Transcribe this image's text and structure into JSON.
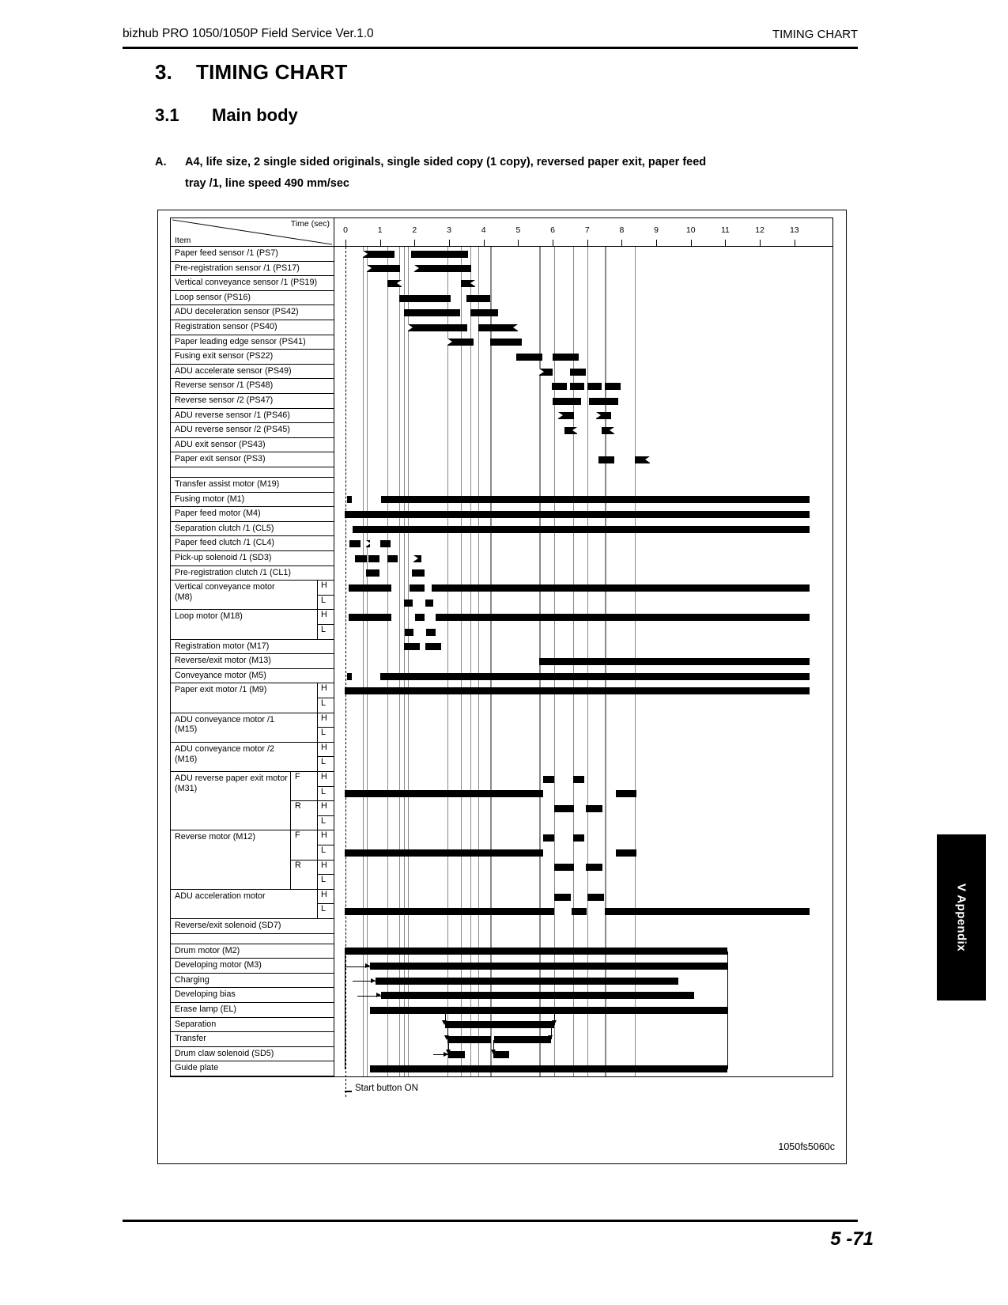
{
  "header": {
    "left": "bizhub PRO 1050/1050P Field Service Ver.1.0",
    "right": "TIMING CHART"
  },
  "titles": {
    "section_number": "3.",
    "section_title": "TIMING CHART",
    "sub_number": "3.1",
    "sub_title": "Main body",
    "item_label": "A.",
    "item_text": "A4, life size, 2 single sided originals, single sided copy (1 copy), reversed paper exit, paper feed",
    "item_text_line2": "tray /1, line speed 490 mm/sec"
  },
  "figure": {
    "id": "1050fs5060c",
    "axis_title": "Time (sec)",
    "item_header": "Item",
    "start_note": "Start button ON"
  },
  "side_tab": {
    "label": "V Appendix"
  },
  "footer": {
    "page": "5 -71"
  },
  "chart_data": {
    "type": "timing",
    "title": "Main body timing chart",
    "xlabel": "Time (sec)",
    "xlim": [
      -0.35,
      13.6
    ],
    "ticks": [
      0,
      1,
      2,
      3,
      4,
      5,
      6,
      7,
      8,
      9,
      10,
      11,
      12,
      13
    ],
    "tick_labels": [
      "0",
      "1",
      "2",
      "3",
      "4",
      "5",
      "6",
      "7",
      "8",
      "9",
      "10",
      "11",
      "12",
      "13"
    ],
    "start_marker": 0,
    "rows": [
      {
        "label": "Paper feed sensor /1 (PS7)",
        "sub": null,
        "bars": [
          {
            "x0": 0.5,
            "x1": 1.42,
            "lead": "open"
          },
          {
            "x0": 1.9,
            "x1": 3.56
          }
        ]
      },
      {
        "label": "Pre-registration sensor /1 (PS17)",
        "sub": null,
        "bars": [
          {
            "x0": 0.62,
            "x1": 1.58,
            "lead": "open"
          },
          {
            "x0": 2.0,
            "x1": 3.65,
            "lead": "open"
          }
        ]
      },
      {
        "label": "Vertical conveyance sensor /1 (PS19)",
        "sub": null,
        "bars": [
          {
            "x0": 1.22,
            "x1": 1.62,
            "tail": "open"
          },
          {
            "x0": 3.35,
            "x1": 3.75,
            "tail": "open"
          }
        ]
      },
      {
        "label": "Loop sensor (PS16)",
        "sub": null,
        "bars": [
          {
            "x0": 1.55,
            "x1": 3.05
          },
          {
            "x0": 3.5,
            "x1": 4.2
          }
        ]
      },
      {
        "label": "ADU deceleration sensor (PS42)",
        "sub": null,
        "bars": [
          {
            "x0": 1.7,
            "x1": 3.32
          },
          {
            "x0": 3.62,
            "x1": 4.42
          }
        ]
      },
      {
        "label": "Registration sensor (PS40)",
        "sub": null,
        "bars": [
          {
            "x0": 1.8,
            "x1": 3.52,
            "lead": "open"
          },
          {
            "x0": 3.85,
            "x1": 5.0,
            "tail": "open"
          }
        ]
      },
      {
        "label": "Paper leading edge sensor (PS41)",
        "sub": null,
        "bars": [
          {
            "x0": 2.95,
            "x1": 3.72,
            "lead": "open"
          },
          {
            "x0": 4.2,
            "x1": 5.1
          }
        ]
      },
      {
        "label": "Fusing exit sensor (PS22)",
        "sub": null,
        "bars": [
          {
            "x0": 4.95,
            "x1": 5.7
          },
          {
            "x0": 6.0,
            "x1": 6.75
          }
        ]
      },
      {
        "label": "ADU accelerate sensor (PS49)",
        "sub": null,
        "bars": [
          {
            "x0": 5.6,
            "x1": 6.0,
            "lead": "open"
          },
          {
            "x0": 6.5,
            "x1": 6.95
          }
        ]
      },
      {
        "label": "Reverse sensor /1 (PS48)",
        "sub": null,
        "bars": [
          {
            "x0": 5.98,
            "x1": 6.42
          },
          {
            "x0": 6.5,
            "x1": 6.92
          },
          {
            "x0": 7.0,
            "x1": 7.42
          },
          {
            "x0": 7.52,
            "x1": 7.96
          }
        ]
      },
      {
        "label": "Reverse sensor /2 (PS47)",
        "sub": null,
        "bars": [
          {
            "x0": 6.0,
            "x1": 6.82
          },
          {
            "x0": 7.05,
            "x1": 7.9
          }
        ]
      },
      {
        "label": "ADU reverse sensor /1 (PS46)",
        "sub": null,
        "bars": [
          {
            "x0": 6.15,
            "x1": 6.62,
            "lead": "open"
          },
          {
            "x0": 7.25,
            "x1": 7.7,
            "lead": "open"
          }
        ]
      },
      {
        "label": "ADU reverse sensor /2 (PS45)",
        "sub": null,
        "bars": [
          {
            "x0": 6.35,
            "x1": 6.7,
            "tail": "open"
          },
          {
            "x0": 7.42,
            "x1": 7.78,
            "tail": "open"
          }
        ]
      },
      {
        "label": "ADU exit sensor (PS43)",
        "sub": null,
        "bars": []
      },
      {
        "label": "Paper exit sensor (PS3)",
        "sub": null,
        "bars": [
          {
            "x0": 7.32,
            "x1": 7.78
          },
          {
            "x0": 8.38,
            "x1": 8.82,
            "tail": "open"
          }
        ]
      },
      {
        "label": "",
        "sub": null,
        "bars": []
      },
      {
        "label": "Transfer assist motor (M19)",
        "sub": null,
        "bars": []
      },
      {
        "label": "Fusing motor (M1)",
        "sub": null,
        "bars": [
          {
            "x0": 0.05,
            "x1": 0.18
          },
          {
            "x0": 1.02,
            "x1": 13.45
          }
        ]
      },
      {
        "label": "Paper feed motor (M4)",
        "sub": null,
        "bars": [
          {
            "x0": -0.02,
            "x1": 13.45
          }
        ]
      },
      {
        "label": "Separation clutch /1 (CL5)",
        "sub": null,
        "bars": [
          {
            "x0": 0.2,
            "x1": 13.45
          }
        ]
      },
      {
        "label": "Paper feed clutch /1 (CL4)",
        "sub": null,
        "bars": [
          {
            "x0": 0.12,
            "x1": 0.43
          },
          {
            "x0": 0.6,
            "x1": 0.72,
            "lead": "open"
          },
          {
            "x0": 1.0,
            "x1": 1.3
          }
        ]
      },
      {
        "label": "Pick-up solenoid /1 (SD3)",
        "sub": null,
        "bars": [
          {
            "x0": 0.28,
            "x1": 0.62
          },
          {
            "x0": 0.66,
            "x1": 0.98
          },
          {
            "x0": 1.22,
            "x1": 1.52
          },
          {
            "x0": 1.98,
            "x1": 2.2,
            "lead": "open"
          }
        ]
      },
      {
        "label": "Pre-registration clutch /1 (CL1)",
        "sub": null,
        "bars": [
          {
            "x0": 0.6,
            "x1": 0.98
          },
          {
            "x0": 1.93,
            "x1": 2.28
          }
        ]
      },
      {
        "label": "Vertical conveyance motor (M8)",
        "sub": "H",
        "bars": [
          {
            "x0": 0.1,
            "x1": 1.32
          },
          {
            "x0": 1.85,
            "x1": 2.3
          },
          {
            "x0": 2.5,
            "x1": 13.45
          }
        ]
      },
      {
        "label": "",
        "sub": "L",
        "bars": [
          {
            "x0": 1.7,
            "x1": 1.95
          },
          {
            "x0": 2.32,
            "x1": 2.55
          }
        ]
      },
      {
        "label": "Loop motor (M18)",
        "sub": "H",
        "bars": [
          {
            "x0": 0.1,
            "x1": 1.32
          },
          {
            "x0": 2.02,
            "x1": 2.3
          },
          {
            "x0": 2.62,
            "x1": 13.45
          }
        ]
      },
      {
        "label": "",
        "sub": "L",
        "bars": [
          {
            "x0": 1.72,
            "x1": 1.98
          },
          {
            "x0": 2.33,
            "x1": 2.6
          }
        ]
      },
      {
        "label": "Registration motor (M17)",
        "sub": null,
        "bars": [
          {
            "x0": 1.7,
            "x1": 2.15
          },
          {
            "x0": 2.32,
            "x1": 2.78
          }
        ]
      },
      {
        "label": "Reverse/exit motor (M13)",
        "sub": null,
        "bars": [
          {
            "x0": 5.62,
            "x1": 13.45
          }
        ]
      },
      {
        "label": "Conveyance motor (M5)",
        "sub": null,
        "bars": [
          {
            "x0": 0.05,
            "x1": 0.18
          },
          {
            "x0": 1.0,
            "x1": 13.45
          }
        ]
      },
      {
        "label": "Paper exit motor /1 (M9)",
        "sub": "H",
        "bars": [
          {
            "x0": -0.02,
            "x1": 13.45
          }
        ]
      },
      {
        "label": "",
        "sub": "L",
        "bars": []
      },
      {
        "label": "ADU conveyance motor /1 (M15)",
        "sub": "H",
        "bars": []
      },
      {
        "label": "",
        "sub": "L",
        "bars": []
      },
      {
        "label": "ADU conveyance motor /2 (M16)",
        "sub": "H",
        "bars": []
      },
      {
        "label": "",
        "sub": "L",
        "bars": []
      },
      {
        "label": "ADU reverse paper exit motor (M31)",
        "sub": "H",
        "sub2": "F",
        "bars": [
          {
            "x0": 5.72,
            "x1": 6.05
          },
          {
            "x0": 6.6,
            "x1": 6.92
          }
        ]
      },
      {
        "label": "",
        "sub": "L",
        "bars": [
          {
            "x0": -0.02,
            "x1": 5.72
          },
          {
            "x0": 7.82,
            "x1": 8.42
          }
        ]
      },
      {
        "label": "",
        "sub": "H",
        "sub2": "R",
        "bars": [
          {
            "x0": 6.05,
            "x1": 6.62
          },
          {
            "x0": 6.95,
            "x1": 7.45
          }
        ]
      },
      {
        "label": "",
        "sub": "L",
        "bars": []
      },
      {
        "label": "Reverse motor (M12)",
        "sub": "H",
        "sub2": "F",
        "bars": [
          {
            "x0": 5.72,
            "x1": 6.05
          },
          {
            "x0": 6.6,
            "x1": 6.92
          }
        ]
      },
      {
        "label": "",
        "sub": "L",
        "bars": [
          {
            "x0": -0.02,
            "x1": 5.72
          },
          {
            "x0": 7.82,
            "x1": 8.42
          }
        ]
      },
      {
        "label": "",
        "sub": "H",
        "sub2": "R",
        "bars": [
          {
            "x0": 6.05,
            "x1": 6.62
          },
          {
            "x0": 6.95,
            "x1": 7.45
          }
        ]
      },
      {
        "label": "",
        "sub": "L",
        "bars": []
      },
      {
        "label": "ADU acceleration motor",
        "sub": "H",
        "bars": [
          {
            "x0": 6.05,
            "x1": 6.52
          },
          {
            "x0": 7.0,
            "x1": 7.48
          }
        ]
      },
      {
        "label": "",
        "sub": "L",
        "bars": [
          {
            "x0": -0.02,
            "x1": 6.05
          },
          {
            "x0": 6.55,
            "x1": 6.98
          },
          {
            "x0": 7.52,
            "x1": 13.45
          }
        ]
      },
      {
        "label": "Reverse/exit solenoid (SD7)",
        "sub": null,
        "bars": []
      },
      {
        "label": "",
        "sub": null,
        "bars": []
      },
      {
        "label": "Drum motor (M2)",
        "sub": null,
        "bars": [
          {
            "x0": -0.02,
            "x1": 11.05
          }
        ]
      },
      {
        "label": "Developing motor (M3)",
        "sub": null,
        "bars": [
          {
            "x0": 0.72,
            "x1": 11.05
          }
        ]
      },
      {
        "label": "Charging",
        "sub": null,
        "bars": [
          {
            "x0": 0.88,
            "x1": 9.65
          }
        ]
      },
      {
        "label": "Developing bias",
        "sub": null,
        "bars": [
          {
            "x0": 1.02,
            "x1": 10.1
          }
        ]
      },
      {
        "label": "Erase lamp (EL)",
        "sub": null,
        "bars": [
          {
            "x0": 0.72,
            "x1": 11.05
          }
        ]
      },
      {
        "label": "Separation",
        "sub": null,
        "bars": [
          {
            "x0": 2.88,
            "x1": 6.05
          }
        ]
      },
      {
        "label": "Transfer",
        "sub": null,
        "bars": [
          {
            "x0": 2.95,
            "x1": 4.22
          },
          {
            "x0": 4.3,
            "x1": 5.95
          }
        ]
      },
      {
        "label": "Drum claw solenoid (SD5)",
        "sub": null,
        "bars": [
          {
            "x0": 2.98,
            "x1": 3.45
          },
          {
            "x0": 4.28,
            "x1": 4.75
          }
        ]
      },
      {
        "label": "Guide plate",
        "sub": null,
        "bars": [
          {
            "x0": 0.72,
            "x1": 11.05
          }
        ]
      }
    ]
  }
}
